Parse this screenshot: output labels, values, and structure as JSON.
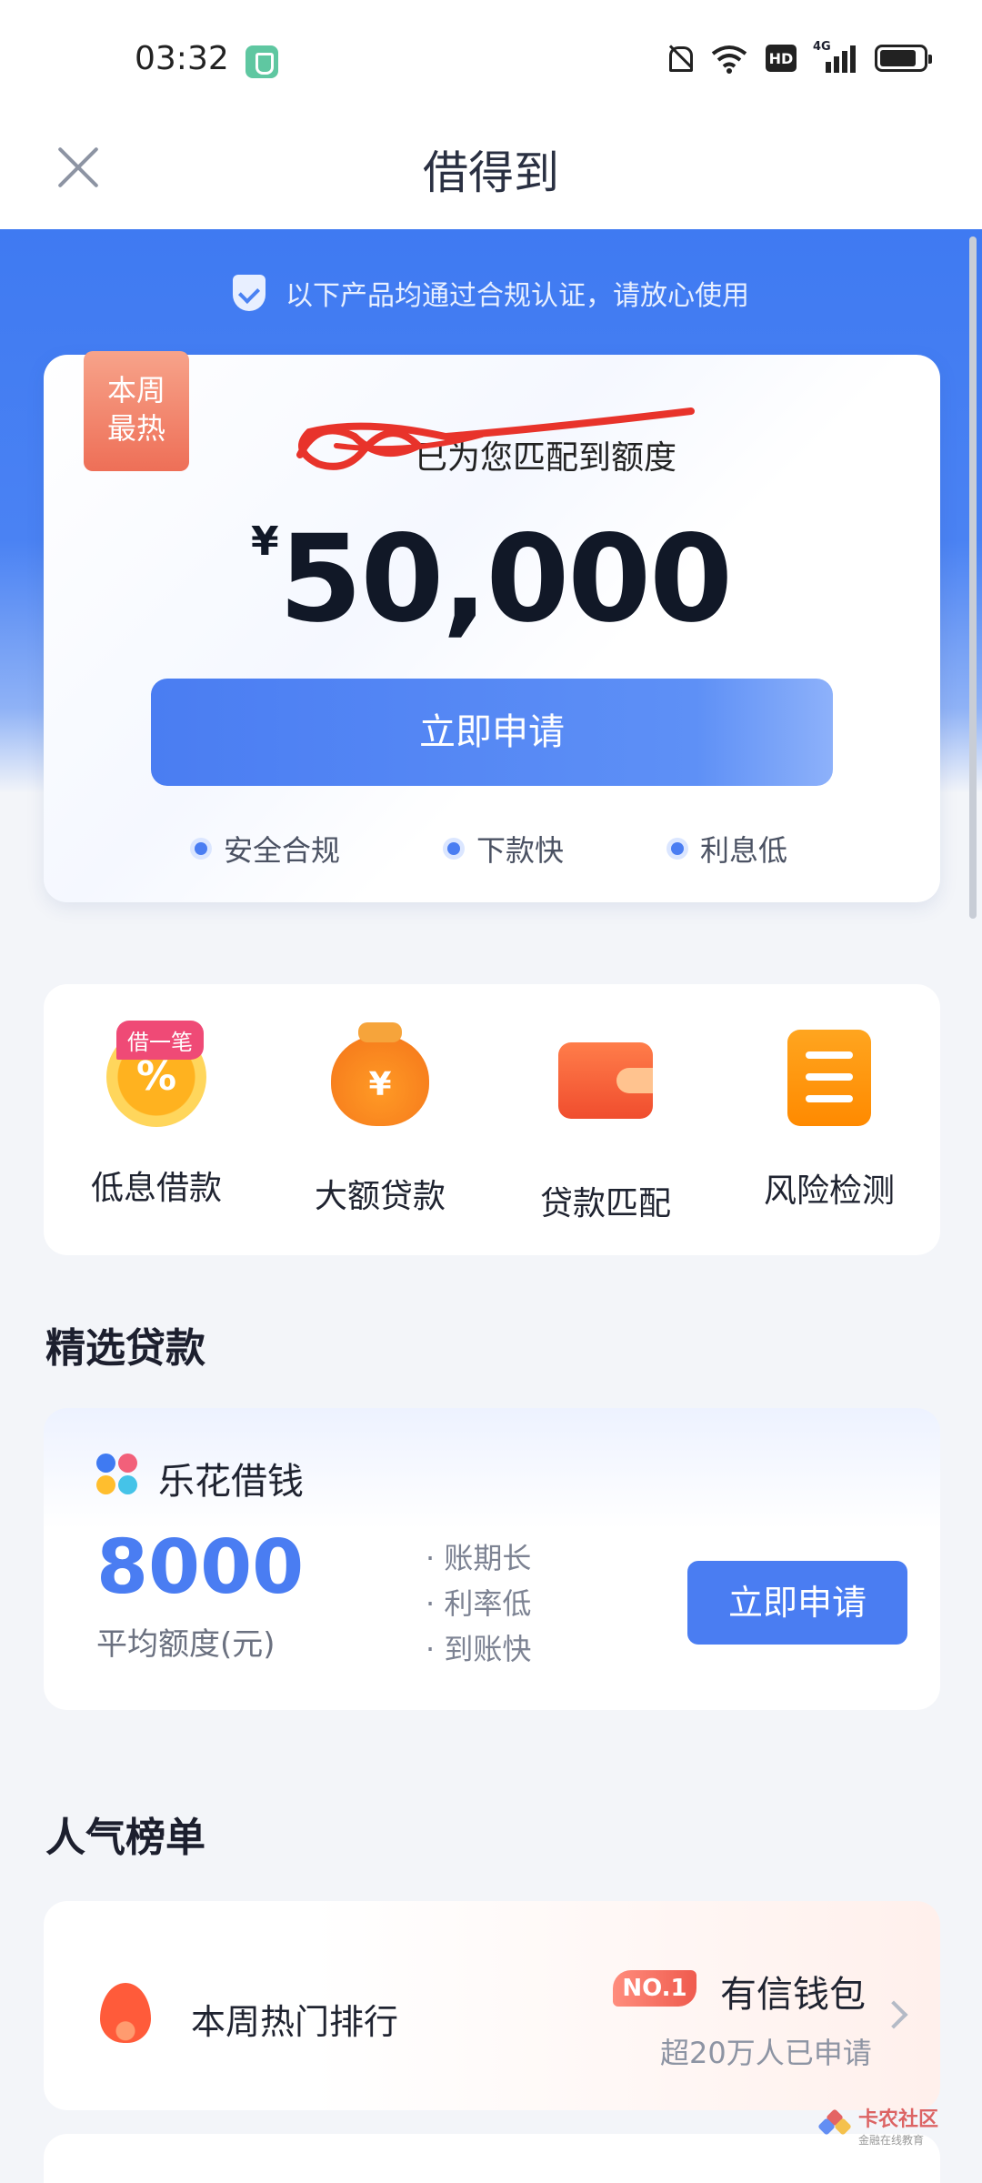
{
  "status_bar": {
    "time": "03:32",
    "hd_label": "HD",
    "network_label": "4G",
    "icons": [
      "shield-app-icon",
      "silent-bell-icon",
      "wifi-icon",
      "hd-icon",
      "signal-icon",
      "battery-icon"
    ]
  },
  "header": {
    "title": "借得到",
    "close_icon": "close-icon"
  },
  "notice": {
    "text": "以下产品均通过合规认证，请放心使用",
    "icon": "shield-check-icon"
  },
  "loan_offer": {
    "badge_line1": "本周",
    "badge_line2": "最热",
    "match_text": "已为您匹配到额度",
    "currency": "¥",
    "amount": "50,000",
    "apply_label": "立即申请",
    "features": [
      "安全合规",
      "下款快",
      "利息低"
    ]
  },
  "quick_actions": {
    "tag": "借一笔",
    "items": [
      {
        "label": "低息借款",
        "icon": "percent-coin-icon",
        "glyph": "%"
      },
      {
        "label": "大额贷款",
        "icon": "money-bag-icon",
        "glyph": "¥"
      },
      {
        "label": "贷款匹配",
        "icon": "wallet-icon"
      },
      {
        "label": "风险检测",
        "icon": "checklist-icon"
      }
    ]
  },
  "featured": {
    "section_title": "精选贷款",
    "product_name": "乐花借钱",
    "amount": "8000",
    "amount_label": "平均额度(元)",
    "features": [
      "· 账期长",
      "· 利率低",
      "· 到账快"
    ],
    "apply_label": "立即申请"
  },
  "ranking": {
    "section_title": "人气榜单",
    "title": "本周热门排行",
    "rank_badge": "NO.1",
    "product": "有信钱包",
    "sub": "超20万人已申请"
  },
  "watermark": {
    "title": "卡农社区",
    "sub": "金融在线教育"
  },
  "colors": {
    "primary": "#4a7df2",
    "hot": "#ee6f57",
    "tag_pink": "#ef4a76"
  }
}
